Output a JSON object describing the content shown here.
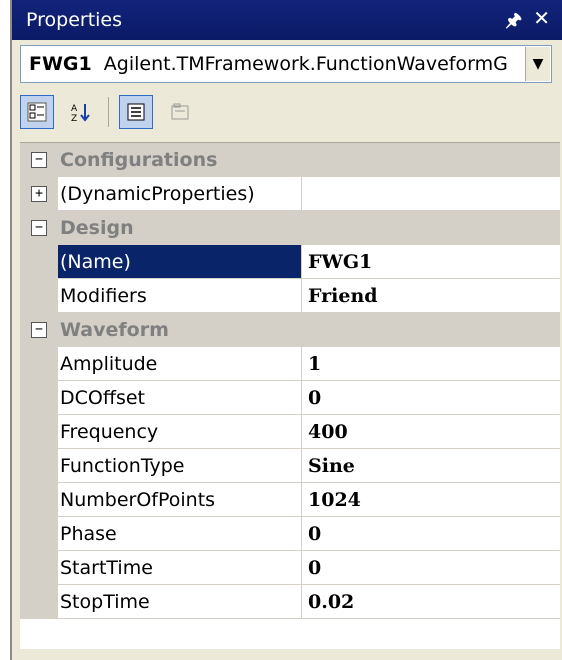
{
  "window": {
    "title": "Properties",
    "pin_icon": "pin-icon",
    "close_icon": "close-icon"
  },
  "selector": {
    "object_name": "FWG1",
    "object_type": "Agilent.TMFramework.FunctionWaveformG"
  },
  "toolbar": {
    "buttons": [
      "categorized-icon",
      "alphabetical-icon",
      "properties-icon",
      "property-pages-icon"
    ]
  },
  "grid": {
    "categories": [
      {
        "label": "Configurations"
      },
      {
        "label": "Design"
      },
      {
        "label": "Waveform"
      }
    ],
    "dynamic_properties": {
      "name": "(DynamicProperties)",
      "value": ""
    },
    "design": [
      {
        "name": "(Name)",
        "value": "FWG1"
      },
      {
        "name": "Modifiers",
        "value": "Friend"
      }
    ],
    "waveform": [
      {
        "name": "Amplitude",
        "value": "1"
      },
      {
        "name": "DCOffset",
        "value": "0"
      },
      {
        "name": "Frequency",
        "value": "400"
      },
      {
        "name": "FunctionType",
        "value": "Sine"
      },
      {
        "name": "NumberOfPoints",
        "value": "1024"
      },
      {
        "name": "Phase",
        "value": "0"
      },
      {
        "name": "StartTime",
        "value": "0"
      },
      {
        "name": "StopTime",
        "value": "0.02"
      }
    ]
  },
  "colors": {
    "title_bar": "#0b1a66",
    "selection": "#0a246a",
    "category_bg": "#d4d0c8"
  }
}
